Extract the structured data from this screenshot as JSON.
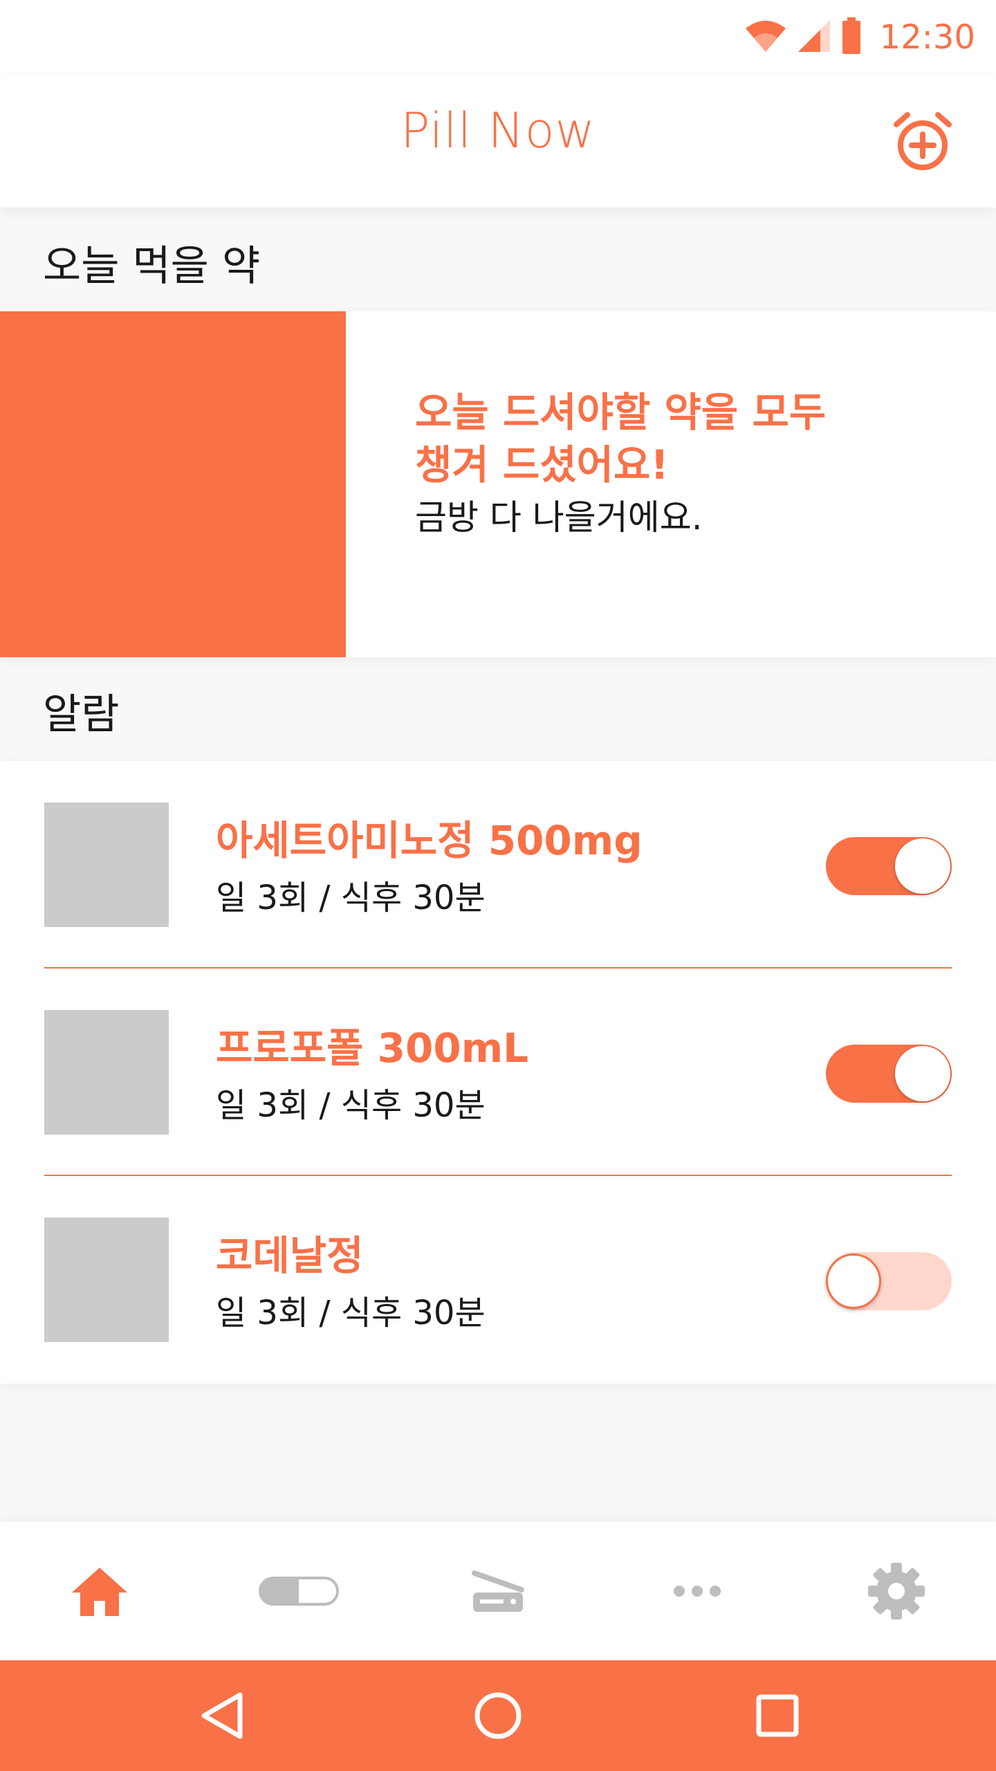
{
  "status_bar": {
    "time": "12:30",
    "icons": [
      "wifi-icon",
      "cellular-signal-icon",
      "battery-icon"
    ]
  },
  "app_bar": {
    "title": "Pill Now",
    "action_icon": "alarm-add-icon"
  },
  "today_section": {
    "title": "오늘 먹을 약",
    "headline_line1": "오늘 드셔야할 약을 모두",
    "headline_line2": "챙겨 드셨어요!",
    "subtext": "금방 다 나을거에요."
  },
  "alarm_section": {
    "title": "알람",
    "items": [
      {
        "name": "아세트아미노정 500mg",
        "schedule": "일 3회 / 식후 30분",
        "enabled": true
      },
      {
        "name": "프로포폴 300mL",
        "schedule": "일 3회 / 식후 30분",
        "enabled": true
      },
      {
        "name": "코데날정",
        "schedule": "일 3회 / 식후 30분",
        "enabled": false
      }
    ]
  },
  "bottom_nav": {
    "items": [
      {
        "icon": "home-icon",
        "active": true
      },
      {
        "icon": "capsule-icon",
        "active": false
      },
      {
        "icon": "scanner-icon",
        "active": false
      },
      {
        "icon": "more-icon",
        "active": false
      },
      {
        "icon": "gear-icon",
        "active": false
      }
    ]
  },
  "system_nav": {
    "icons": [
      "back-icon",
      "home-circle-icon",
      "recents-icon"
    ]
  },
  "colors": {
    "accent": "#f97147",
    "accent_light": "#fdd7cc",
    "placeholder": "#cbcbcb",
    "nav_inactive": "#bdbdbd"
  }
}
